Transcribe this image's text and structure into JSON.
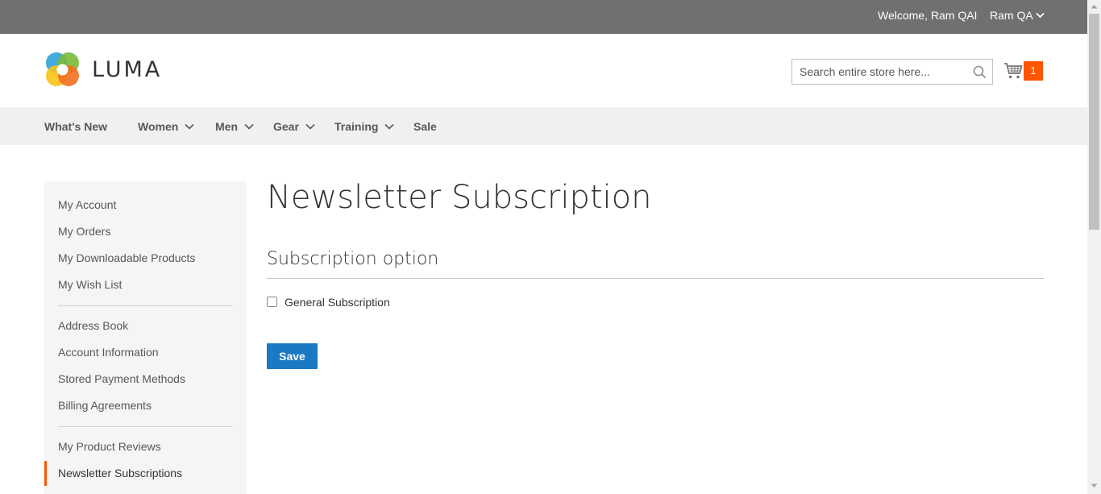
{
  "topbar": {
    "welcome_text": "Welcome, Ram QAI",
    "customer_menu_label": "Ram QA"
  },
  "header": {
    "logo_text": "LUMA",
    "search_placeholder": "Search entire store here...",
    "cart_count": "1"
  },
  "nav": {
    "items": [
      {
        "label": "What's New",
        "has_submenu": false
      },
      {
        "label": "Women",
        "has_submenu": true
      },
      {
        "label": "Men",
        "has_submenu": true
      },
      {
        "label": "Gear",
        "has_submenu": true
      },
      {
        "label": "Training",
        "has_submenu": true
      },
      {
        "label": "Sale",
        "has_submenu": false
      }
    ]
  },
  "sidebar": {
    "items": [
      {
        "label": "My Account"
      },
      {
        "label": "My Orders"
      },
      {
        "label": "My Downloadable Products"
      },
      {
        "label": "My Wish List"
      },
      {
        "label": "Address Book"
      },
      {
        "label": "Account Information"
      },
      {
        "label": "Stored Payment Methods"
      },
      {
        "label": "Billing Agreements"
      },
      {
        "label": "My Product Reviews"
      },
      {
        "label": "Newsletter Subscriptions",
        "active": true
      }
    ]
  },
  "main": {
    "page_title": "Newsletter Subscription",
    "section_legend": "Subscription option",
    "checkbox_label": "General Subscription",
    "checkbox_checked": false,
    "save_label": "Save"
  },
  "colors": {
    "topbar_bg": "#6e716e",
    "nav_bg": "#f0f0f0",
    "accent_orange": "#ff5501",
    "primary_button": "#1979c3",
    "sidebar_bg": "#f5f5f5"
  }
}
